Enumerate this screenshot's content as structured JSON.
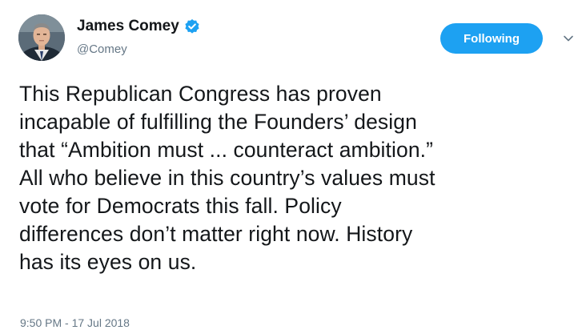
{
  "author": {
    "display_name": "James Comey",
    "handle": "@Comey",
    "verified": true,
    "avatar_icon": "profile-photo"
  },
  "follow_button": {
    "label": "Following",
    "color": "#1da1f2"
  },
  "menu": {
    "icon": "chevron-down-icon"
  },
  "tweet": {
    "text": "This Republican Congress has proven\nincapable of fulfilling the Founders’ design\nthat “Ambition must ... counteract ambition.”\nAll who believe in this country’s values must\nvote for Democrats this fall. Policy\ndifferences don’t matter right now. History\nhas its eyes on us.",
    "timestamp": "9:50 PM - 17 Jul 2018"
  },
  "colors": {
    "text": "#14171a",
    "secondary": "#657786",
    "accent": "#1da1f2"
  }
}
